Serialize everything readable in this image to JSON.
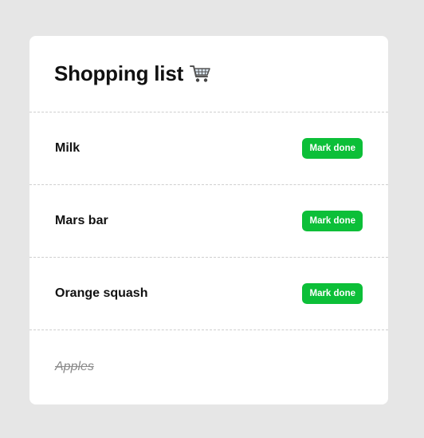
{
  "header": {
    "title": "Shopping list",
    "title_icon": "shopping-cart-icon"
  },
  "items": [
    {
      "label": "Milk",
      "done": false,
      "action_label": "Mark done"
    },
    {
      "label": "Mars bar",
      "done": false,
      "action_label": "Mark done"
    },
    {
      "label": "Orange squash",
      "done": false,
      "action_label": "Mark done"
    },
    {
      "label": "Apples",
      "done": true
    }
  ],
  "colors": {
    "background": "#e6e6e6",
    "card": "#ffffff",
    "button": "#0cbf38",
    "done_text": "#8a8a8a"
  }
}
